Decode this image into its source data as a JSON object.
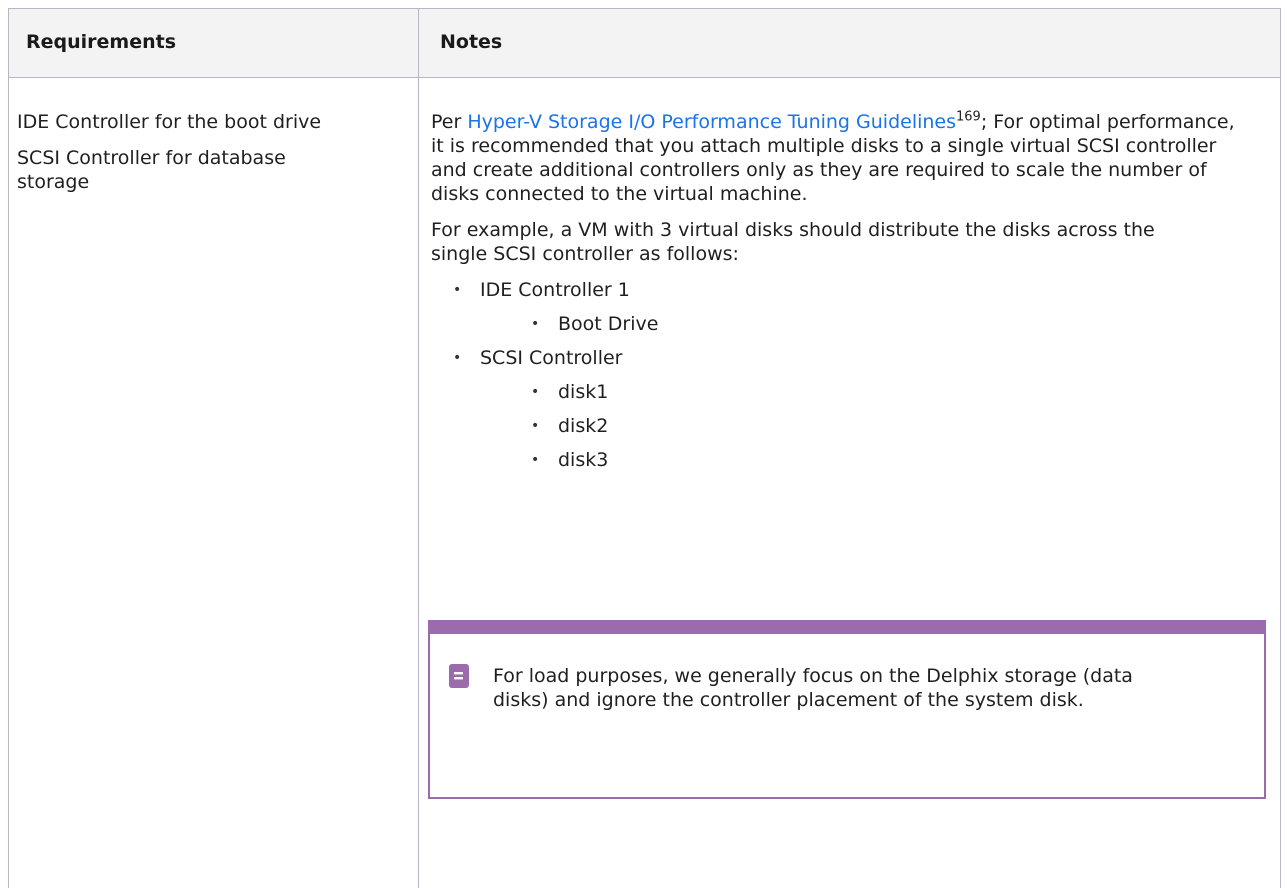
{
  "table": {
    "headers": {
      "requirements": "Requirements",
      "notes": "Notes"
    },
    "requirements": [
      "IDE Controller for the boot drive",
      "SCSI Controller for database storage"
    ],
    "notes": {
      "intro_prefix": "Per ",
      "link_text": "Hyper-V Storage I/O Performance Tuning Guidelines",
      "footnote": "169",
      "intro_suffix": "; For optimal performance, it is recommended that you attach multiple disks to a single virtual SCSI controller and create additional controllers only as they are required to scale the number of disks connected to the virtual machine.",
      "example": "For example, a VM with 3 virtual disks should distribute the disks across the single SCSI controller as follows:",
      "list": [
        {
          "label": "IDE Controller 1",
          "children": [
            "Boot Drive"
          ]
        },
        {
          "label": "SCSI Controller",
          "children": [
            "disk1",
            "disk2",
            "disk3"
          ]
        }
      ],
      "callout": "For load purposes, we generally focus on the Delphix storage (data disks) and ignore the controller placement of the system disk."
    }
  },
  "colors": {
    "accent": "#9b6bae",
    "link": "#1a73e8",
    "border": "#b9b6c8",
    "header_bg": "#f3f3f3"
  },
  "icons": {
    "callout": "note-icon",
    "bullet": "bullet-dot"
  }
}
